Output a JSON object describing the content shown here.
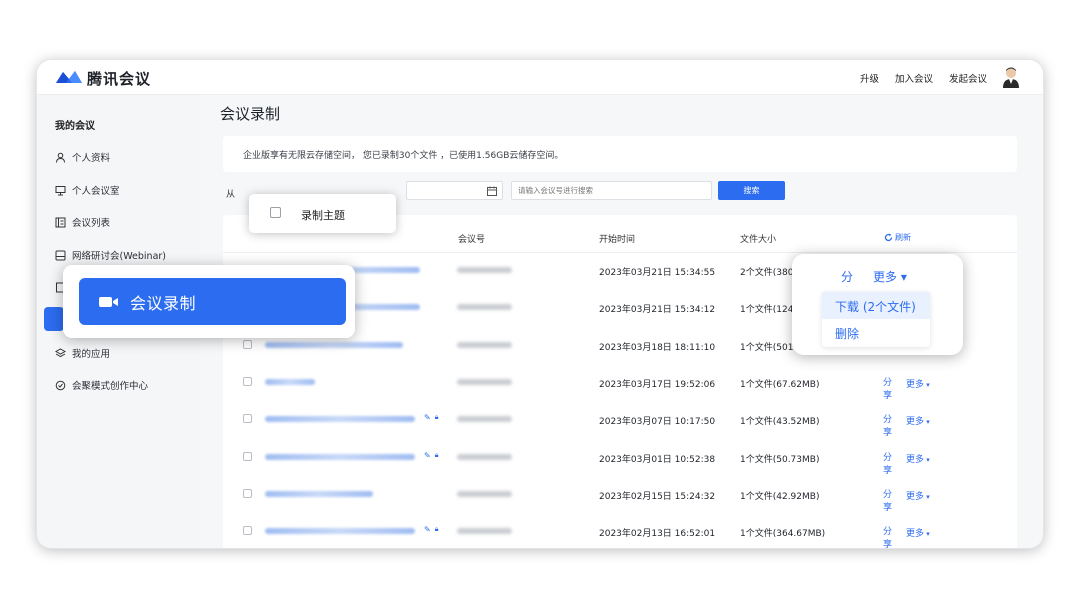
{
  "app": {
    "name": "腾讯会议"
  },
  "topbar": {
    "actions": [
      "升级",
      "加入会议",
      "发起会议"
    ]
  },
  "sidebar": {
    "title": "我的会议",
    "items": [
      {
        "label": "个人资料",
        "icon": "person-icon"
      },
      {
        "label": "个人会议室",
        "icon": "monitor-icon"
      },
      {
        "label": "会议列表",
        "icon": "list-icon"
      },
      {
        "label": "网络研讨会(Webinar)",
        "icon": "webinar-icon"
      },
      {
        "label": "我的应用",
        "icon": "layers-icon"
      },
      {
        "label": "会聚模式创作中心",
        "icon": "clock-check-icon"
      }
    ]
  },
  "page": {
    "title": "会议录制",
    "notice": "企业版享有无限云存储空间， 您已录制30个文件 ，已使用1.56GB云储存空间。",
    "filter_from": "从",
    "search_placeholder": "请输入会议号进行搜索",
    "search_button": "搜索"
  },
  "table": {
    "headers": {
      "meeting_id": "会议号",
      "start_time": "开始时间",
      "file_size": "文件大小",
      "refresh": "刷新"
    },
    "share_label": "分享",
    "more_label": "更多",
    "rows": [
      {
        "start": "2023年03月21日 15:34:55",
        "size": "2个文件(380",
        "title_w": 155,
        "icons": false
      },
      {
        "start": "2023年03月21日 15:34:12",
        "size": "1个文件(124.",
        "title_w": 155,
        "icons": false
      },
      {
        "start": "2023年03月18日 18:11:10",
        "size": "1个文件(501.",
        "title_w": 138,
        "icons": false
      },
      {
        "start": "2023年03月17日 19:52:06",
        "size": "1个文件(67.62MB)",
        "title_w": 50,
        "icons": false
      },
      {
        "start": "2023年03月07日 10:17:50",
        "size": "1个文件(43.52MB)",
        "title_w": 150,
        "icons": true
      },
      {
        "start": "2023年03月01日 10:52:38",
        "size": "1个文件(50.73MB)",
        "title_w": 150,
        "icons": true
      },
      {
        "start": "2023年02月15日 15:24:32",
        "size": "1个文件(42.92MB)",
        "title_w": 108,
        "icons": false
      },
      {
        "start": "2023年02月13日 16:52:01",
        "size": "1个文件(364.67MB)",
        "title_w": 150,
        "icons": true
      }
    ]
  },
  "callouts": {
    "topic_checkbox_label": "录制主题",
    "nav_label": "会议录制",
    "menu": {
      "share": "分享",
      "more": "更多",
      "items": [
        "下载 (2个文件)",
        "删除"
      ]
    }
  },
  "colors": {
    "accent": "#2c6cf0"
  }
}
